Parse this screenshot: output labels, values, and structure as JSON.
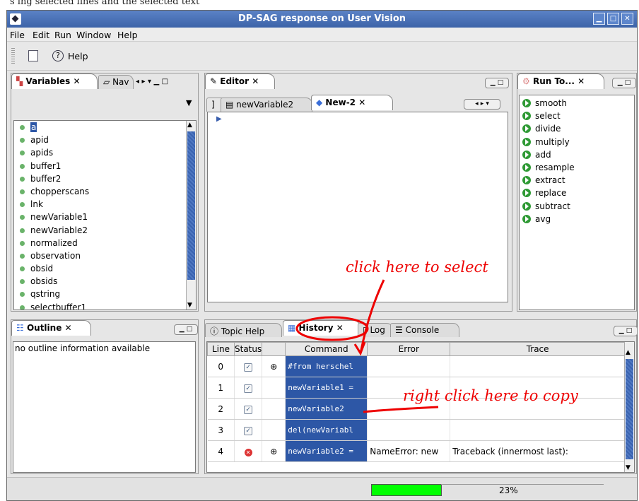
{
  "caption_cut": "s ing selected lines and the selected text",
  "window": {
    "title": "DP-SAG response on User Vision"
  },
  "menu": [
    "File",
    "Edit",
    "Run",
    "Window",
    "Help"
  ],
  "toolbar": {
    "help_label": "Help"
  },
  "variables": {
    "tab_label": "Variables",
    "other_tab": "Nav",
    "items": [
      "a",
      "apid",
      "apids",
      "buffer1",
      "buffer2",
      "chopperscans",
      "lnk",
      "newVariable1",
      "newVariable2",
      "normalized",
      "observation",
      "obsid",
      "obsids",
      "qstring",
      "selectbuffer1"
    ],
    "selected_index": 0
  },
  "editor": {
    "tab_label": "Editor",
    "inner_tabs": [
      "]",
      "newVariable2",
      "New-2"
    ]
  },
  "run": {
    "tab_label": "Run To...",
    "items": [
      "smooth",
      "select",
      "divide",
      "multiply",
      "add",
      "resample",
      "extract",
      "replace",
      "subtract",
      "avg"
    ]
  },
  "outline": {
    "tab_label": "Outline",
    "message": "no outline information available"
  },
  "bottom_tabs": [
    "Topic Help",
    "History",
    "Log",
    "Console"
  ],
  "history": {
    "columns": [
      "Line",
      "Status",
      "",
      "Command",
      "Error",
      "Trace"
    ],
    "rows": [
      {
        "line": "0",
        "status": "ok",
        "expand": "⊕",
        "command": "#from herschel",
        "error": "",
        "trace": ""
      },
      {
        "line": "1",
        "status": "ok",
        "expand": "",
        "command": "newVariable1 =",
        "error": "",
        "trace": ""
      },
      {
        "line": "2",
        "status": "ok",
        "expand": "",
        "command": "newVariable2",
        "error": "",
        "trace": ""
      },
      {
        "line": "3",
        "status": "ok",
        "expand": "",
        "command": "del(newVariabl",
        "error": "",
        "trace": ""
      },
      {
        "line": "4",
        "status": "error",
        "expand": "⊕",
        "command": "newVariable2 =",
        "error": "NameError: new",
        "trace": "Traceback (innermost last):"
      }
    ]
  },
  "progress": {
    "label": "23%",
    "value": 23
  },
  "annotations": {
    "select": "click here to select",
    "copy": "right click here to copy"
  },
  "colors": {
    "selection": "#2d57a6",
    "annotation": "#e00000",
    "progress": "#00ff00"
  }
}
